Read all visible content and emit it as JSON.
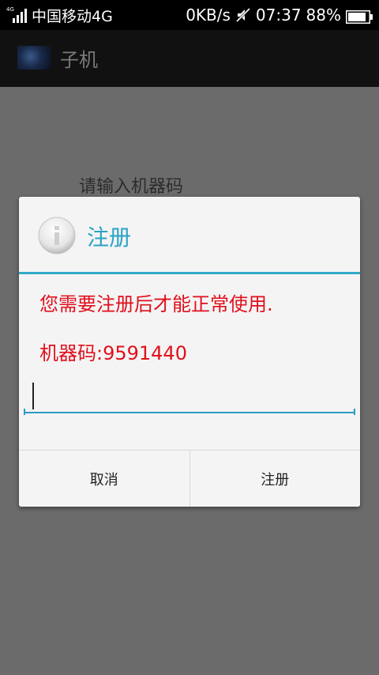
{
  "status_bar": {
    "network_type": "4G",
    "carrier": "中国移动4G",
    "data_speed": "0KB/s",
    "time": "07:37",
    "battery_percent": "88%",
    "battery_level": 0.88,
    "icons": [
      "signal-icon",
      "mute-icon",
      "battery-icon"
    ]
  },
  "app_bar": {
    "title": "子机",
    "icon": "app-icon"
  },
  "background": {
    "hint_text": "请输入机器码"
  },
  "dialog": {
    "icon": "info-icon",
    "title": "注册",
    "message": "您需要注册后才能正常使用.",
    "machine_code": "机器码:9591440",
    "input_value": "",
    "buttons": {
      "cancel": "取消",
      "register": "注册"
    },
    "colors": {
      "title": "#2aa3c6",
      "accent": "#33aacb",
      "message": "#e0101c"
    }
  }
}
